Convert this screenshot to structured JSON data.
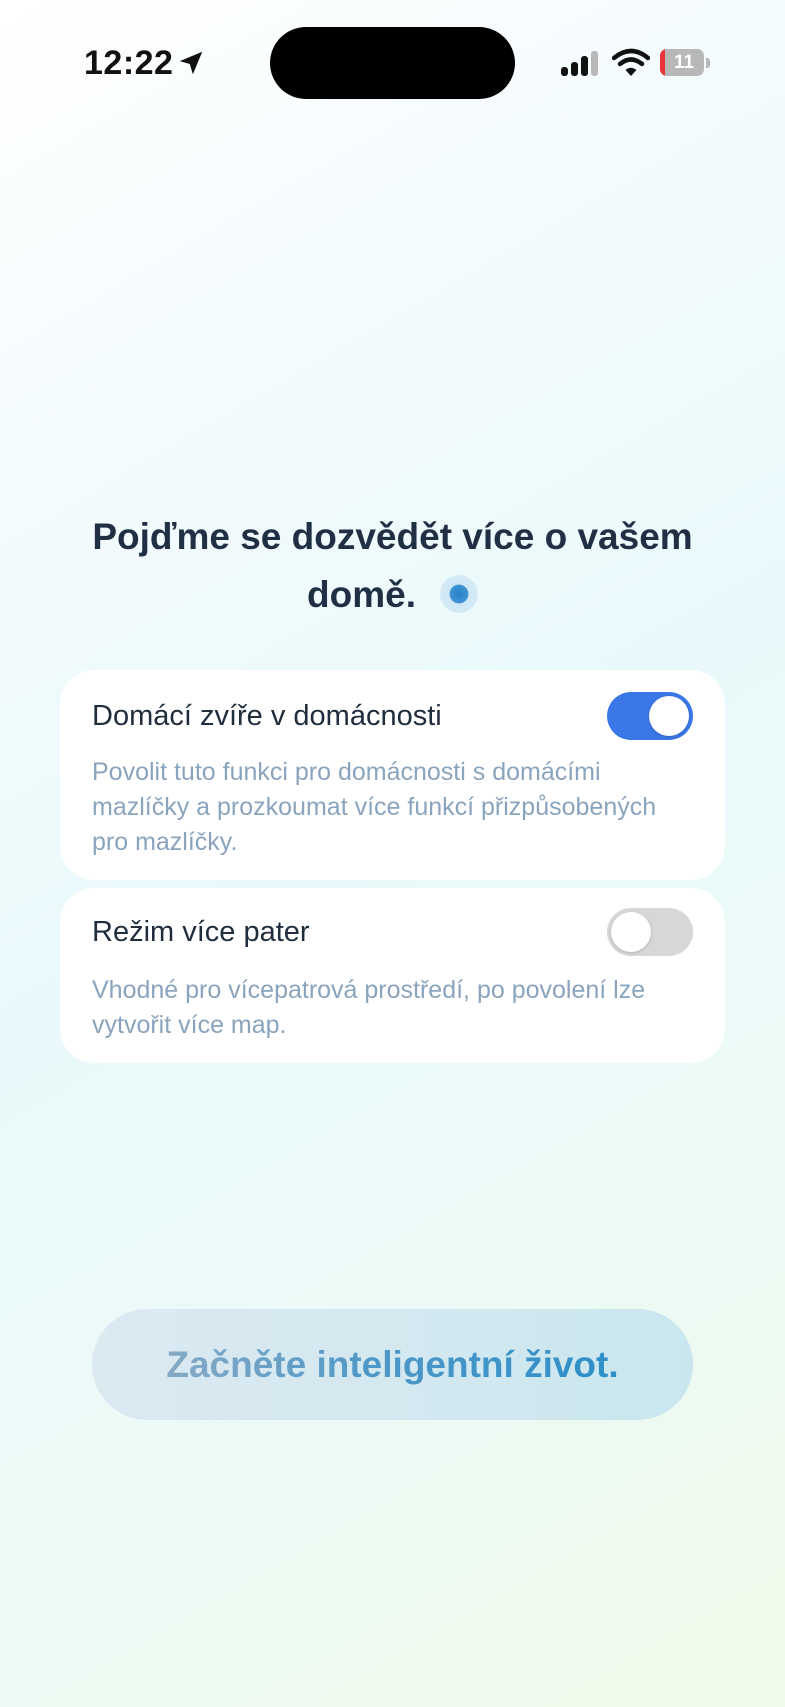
{
  "status_bar": {
    "time": "12:22",
    "battery_level": "11",
    "battery_color": "#e8343d",
    "icons": [
      "location-arrow-icon",
      "cellular-signal-icon",
      "wifi-icon",
      "battery-icon"
    ]
  },
  "heading": {
    "text": "Pojďme se dozvědět více o vašem domě."
  },
  "settings": [
    {
      "title": "Domácí zvíře v domácnosti",
      "description": "Povolit tuto funkci pro domácnosti s domácími mazlíčky a prozkoumat více funkcí přizpůsobených pro mazlíčky.",
      "enabled": true
    },
    {
      "title": "Režim více pater",
      "description": "Vhodné pro vícepatrová prostředí, po povolení lze vytvořit více map.",
      "enabled": false
    }
  ],
  "cta": {
    "label": "Začněte inteligentní život."
  },
  "colors": {
    "toggle_on": "#3b78e7",
    "toggle_off": "#d5d7d9",
    "heading": "#1f3044",
    "description": "#8aa4bd"
  }
}
